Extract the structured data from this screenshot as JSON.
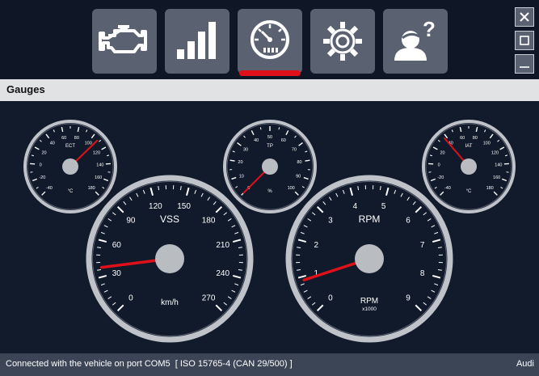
{
  "toolbar": {
    "buttons": [
      {
        "name": "engine-diagnostics-button",
        "icon": "engine-icon",
        "active": false
      },
      {
        "name": "live-data-button",
        "icon": "signal-bars-icon",
        "active": false
      },
      {
        "name": "gauges-button",
        "icon": "speedometer-icon",
        "active": true
      },
      {
        "name": "settings-button",
        "icon": "gear-icon",
        "active": false
      },
      {
        "name": "help-button",
        "icon": "help-user-icon",
        "active": false
      }
    ],
    "active_indicator_color": "#e0101a",
    "window_controls": [
      "close-icon",
      "maximize-icon",
      "minimize-icon"
    ]
  },
  "header": {
    "title": "Gauges"
  },
  "gauges": [
    {
      "id": "ect",
      "label": "ECT",
      "unit": "°C",
      "ticks": [
        "-40",
        "-20",
        "0",
        "20",
        "40",
        "60",
        "80",
        "100",
        "120",
        "140",
        "160",
        "180"
      ],
      "value_fraction": 0.67
    },
    {
      "id": "tp",
      "label": "TP",
      "unit": "%",
      "ticks": [
        "0",
        "10",
        "20",
        "30",
        "40",
        "50",
        "60",
        "70",
        "80",
        "90",
        "100"
      ],
      "value_fraction": 0.0
    },
    {
      "id": "iat",
      "label": "IAT",
      "unit": "°C",
      "ticks": [
        "-40",
        "-20",
        "0",
        "20",
        "40",
        "60",
        "80",
        "100",
        "120",
        "140",
        "160",
        "180"
      ],
      "value_fraction": 0.35
    },
    {
      "id": "vss",
      "label": "VSS",
      "unit": "km/h",
      "ticks": [
        "0",
        "30",
        "60",
        "90",
        "120",
        "150",
        "180",
        "210",
        "240",
        "270"
      ],
      "value_fraction": 0.14
    },
    {
      "id": "rpm",
      "label": "RPM",
      "unit": "RPM",
      "unit_sub": "x1000",
      "ticks": [
        "0",
        "1",
        "2",
        "3",
        "4",
        "5",
        "6",
        "7",
        "8",
        "9"
      ],
      "value_fraction": 0.1
    }
  ],
  "status": {
    "connection": "Connected with the vehicle on port COM5  [ ISO 15765-4 (CAN 29/500) ]",
    "brand": "Audi"
  },
  "colors": {
    "needle": "#e0101a",
    "bezel": "#bfc3c9",
    "panel": "#121b2c"
  }
}
